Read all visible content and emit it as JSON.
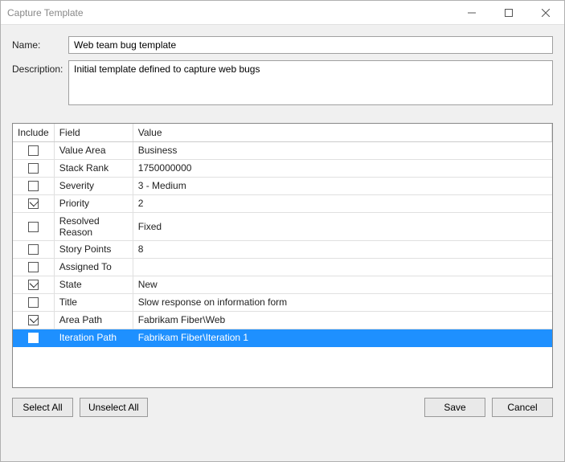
{
  "window": {
    "title": "Capture Template"
  },
  "labels": {
    "name": "Name:",
    "description": "Description:"
  },
  "fields": {
    "name": "Web team bug template",
    "description": "Initial template defined to capture web bugs"
  },
  "table": {
    "headers": {
      "include": "Include",
      "field": "Field",
      "value": "Value"
    },
    "rows": [
      {
        "include": false,
        "field": "Value Area",
        "value": "Business",
        "selected": false
      },
      {
        "include": false,
        "field": "Stack Rank",
        "value": "1750000000",
        "selected": false
      },
      {
        "include": false,
        "field": "Severity",
        "value": "3 - Medium",
        "selected": false
      },
      {
        "include": true,
        "field": "Priority",
        "value": "2",
        "selected": false
      },
      {
        "include": false,
        "field": "Resolved Reason",
        "value": "Fixed",
        "selected": false
      },
      {
        "include": false,
        "field": "Story Points",
        "value": "8",
        "selected": false
      },
      {
        "include": false,
        "field": "Assigned To",
        "value": "",
        "selected": false
      },
      {
        "include": true,
        "field": "State",
        "value": "New",
        "selected": false
      },
      {
        "include": false,
        "field": "Title",
        "value": "Slow response on information form",
        "selected": false
      },
      {
        "include": true,
        "field": "Area Path",
        "value": "Fabrikam Fiber\\Web",
        "selected": false
      },
      {
        "include": false,
        "field": "Iteration Path",
        "value": "Fabrikam Fiber\\Iteration 1",
        "selected": true
      }
    ]
  },
  "buttons": {
    "selectAll": "Select All",
    "unselectAll": "Unselect All",
    "save": "Save",
    "cancel": "Cancel"
  }
}
